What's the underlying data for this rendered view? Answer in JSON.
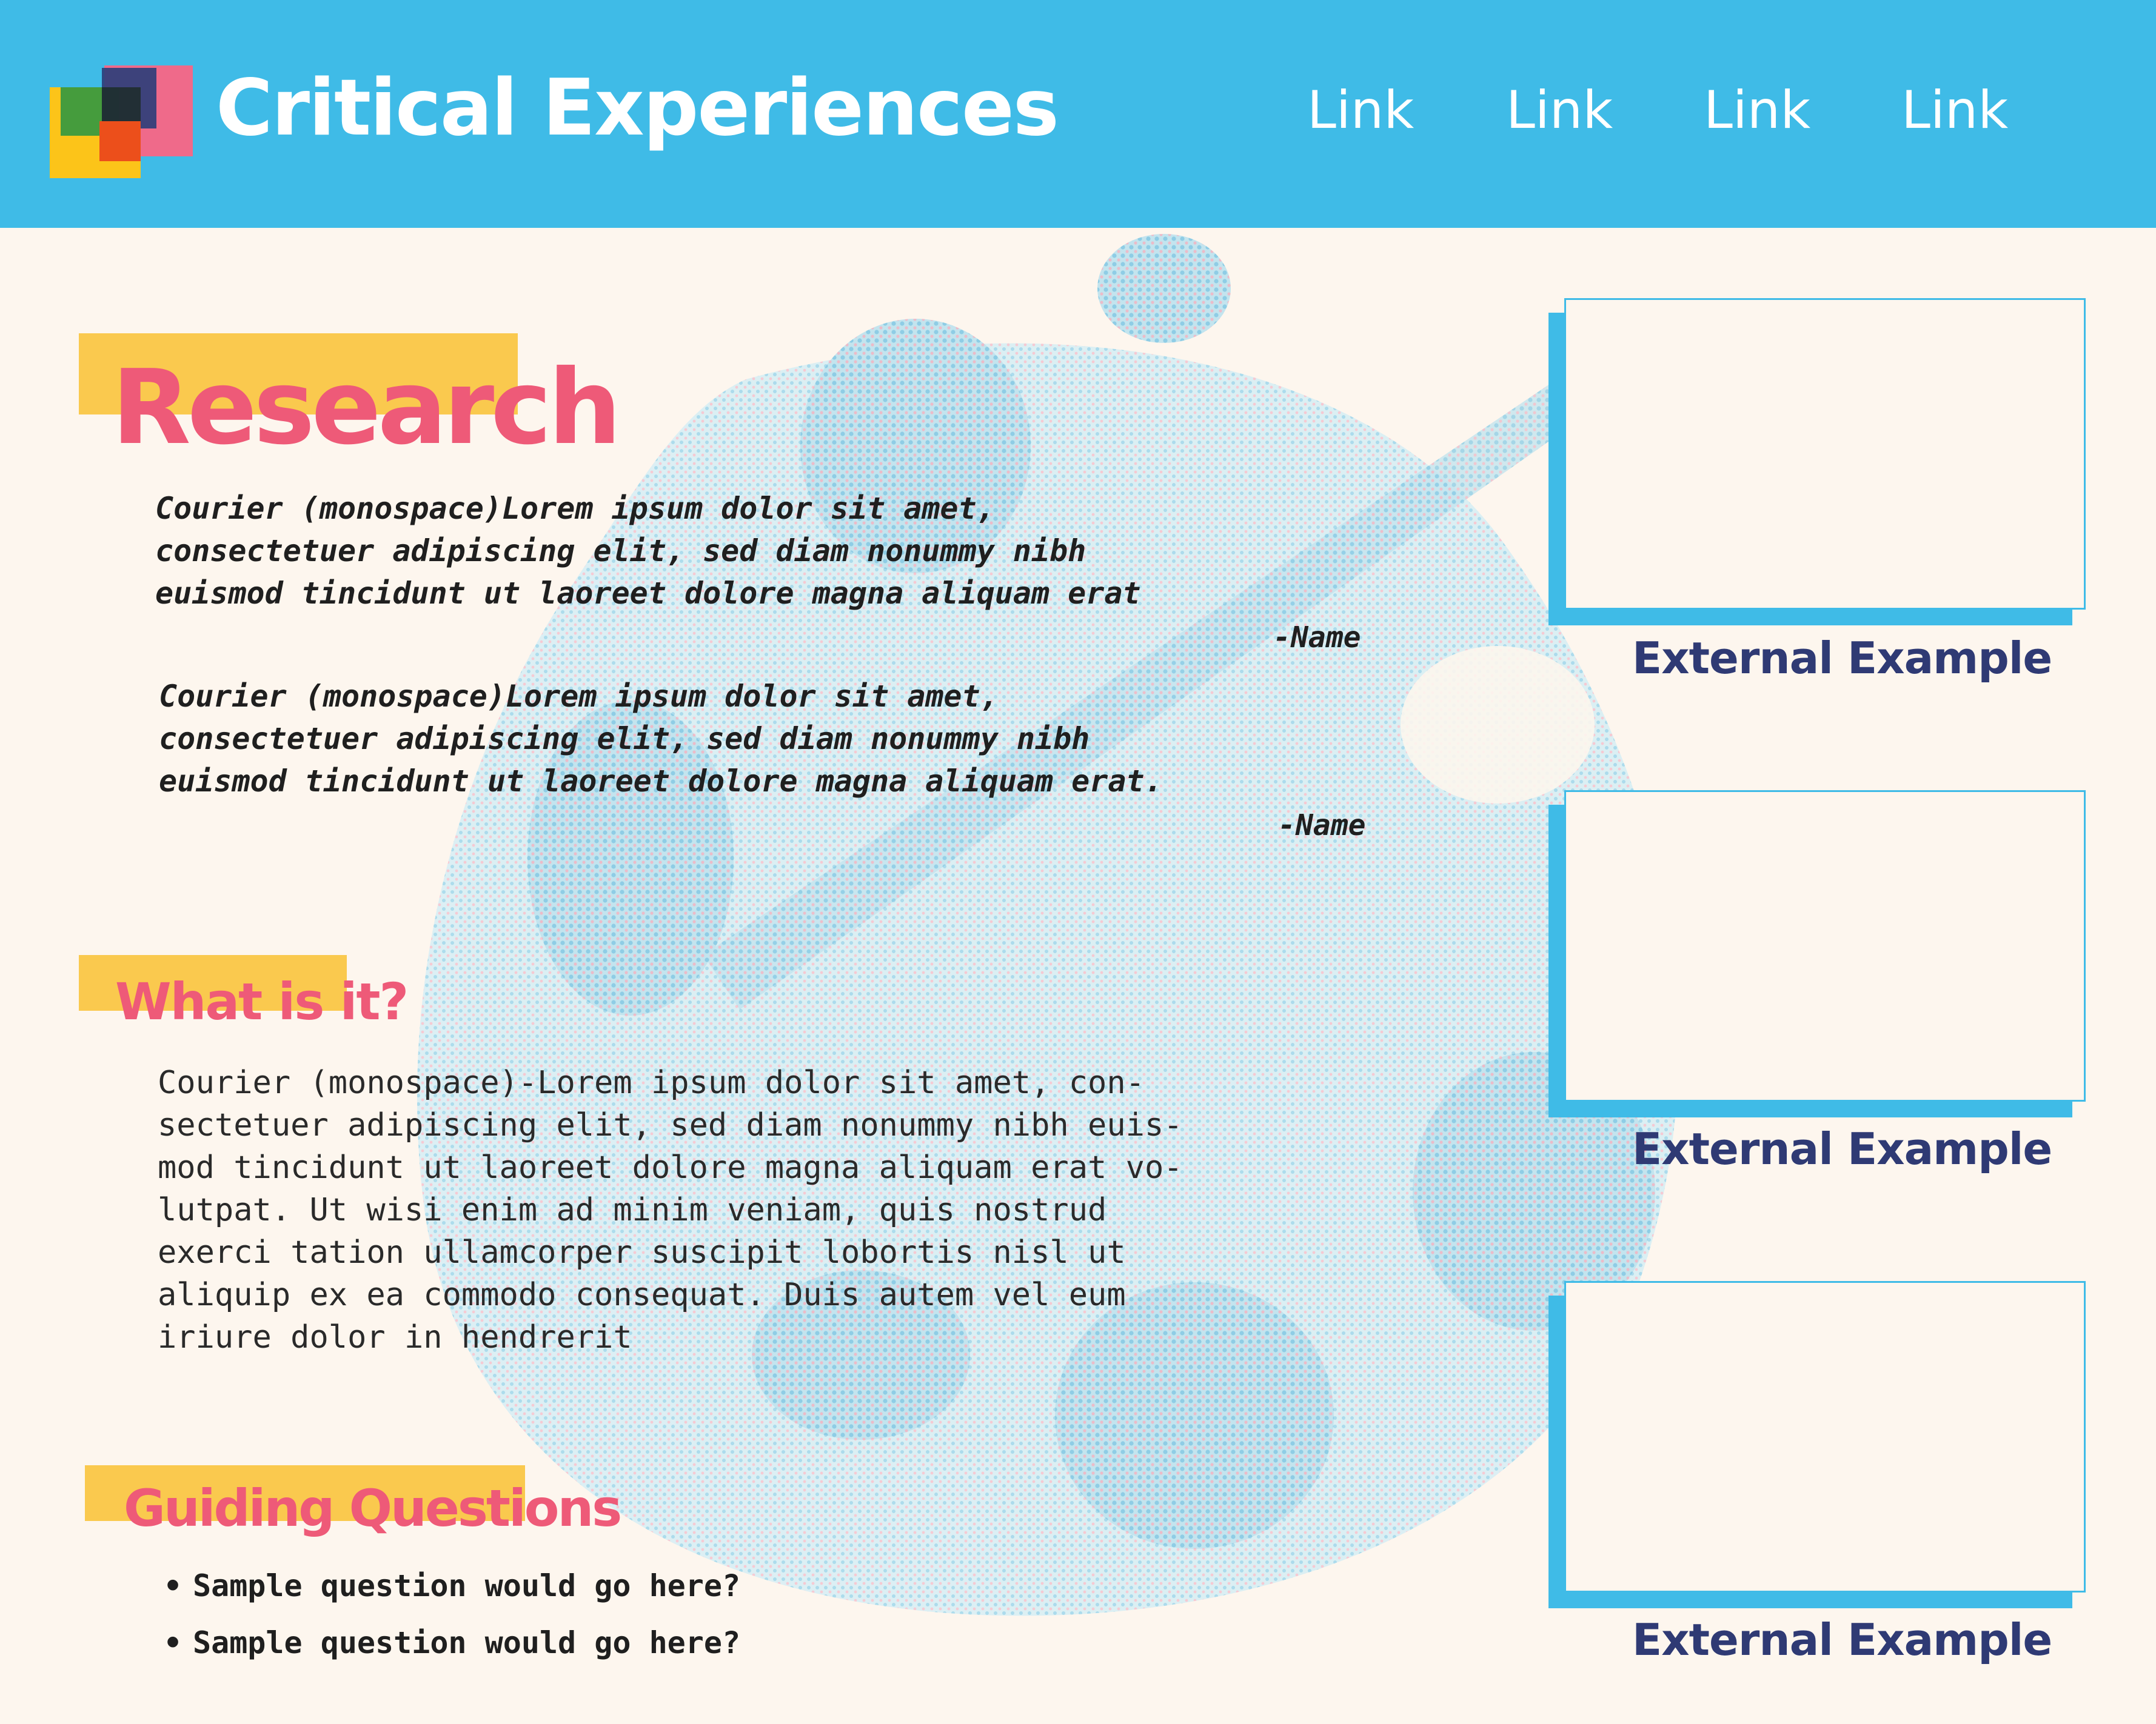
{
  "header": {
    "title": "Critical Experiences",
    "nav_links": [
      "Link",
      "Link",
      "Link",
      "Link"
    ]
  },
  "sections": {
    "research": {
      "heading": "Research",
      "quotes": [
        {
          "lines": [
            "Courier (monospace)Lorem ipsum dolor sit amet,",
            "consectetuer adipiscing elit, sed diam nonummy nibh",
            "euismod tincidunt ut laoreet dolore magna aliquam erat"
          ],
          "attribution": "-Name"
        },
        {
          "lines": [
            "Courier (monospace)Lorem ipsum dolor sit amet,",
            "consectetuer adipiscing elit, sed diam nonummy nibh",
            "euismod tincidunt ut laoreet dolore magna aliquam erat."
          ],
          "attribution": "-Name"
        }
      ]
    },
    "what_is_it": {
      "heading": "What is it?",
      "lines": [
        "Courier (monospace)-Lorem ipsum dolor sit amet, con-",
        "sectetuer adipiscing elit, sed diam nonummy nibh euis-",
        "mod tincidunt ut laoreet dolore magna aliquam erat vo-",
        "lutpat. Ut wisi enim ad minim veniam, quis nostrud",
        "exerci tation ullamcorper suscipit lobortis nisl ut",
        "aliquip ex ea commodo consequat. Duis autem vel eum",
        "iriure dolor in hendrerit"
      ]
    },
    "guiding_questions": {
      "heading": "Guiding Questions",
      "bullet": "•",
      "items": [
        "Sample question would go here?",
        "Sample question would go here?"
      ]
    }
  },
  "examples": [
    {
      "caption": "External Example"
    },
    {
      "caption": "External Example"
    },
    {
      "caption": "External Example"
    }
  ],
  "colors": {
    "header_blue": "#3fbbe7",
    "page_cream": "#fdf6ee",
    "heading_pink": "#ee5a78",
    "highlight_yellow": "#fac94e",
    "caption_navy": "#2f3a74"
  },
  "icons": {
    "logo": "overlapping-squares-logo",
    "background": "paint-palette-halftone"
  }
}
